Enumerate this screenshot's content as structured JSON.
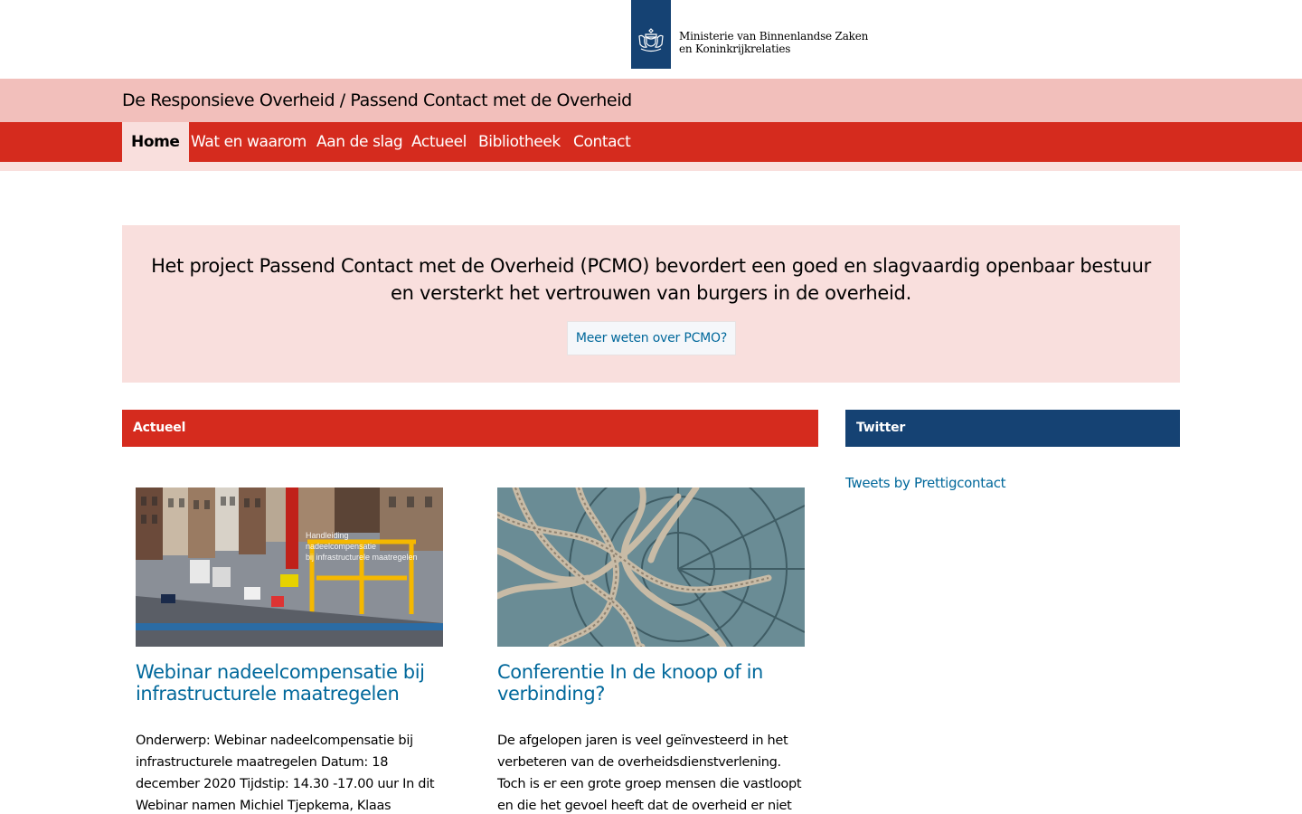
{
  "header": {
    "ministry_line1": "Ministerie van Binnenlandse Zaken",
    "ministry_line2": "en Koninkrijkrelaties",
    "logo_icon": "crest-icon",
    "brand_color": "#154273"
  },
  "site": {
    "title": "De Responsieve Overheid / Passend Contact met de Overheid"
  },
  "nav": {
    "items": [
      {
        "label": "Home",
        "active": true
      },
      {
        "label": "Wat en waarom",
        "active": false
      },
      {
        "label": "Aan de slag",
        "active": false
      },
      {
        "label": "Actueel",
        "active": false
      },
      {
        "label": "Bibliotheek",
        "active": false
      },
      {
        "label": "Contact",
        "active": false
      }
    ],
    "color": "#d52b1e"
  },
  "intro": {
    "text": "Het project Passend Contact met de Overheid (PCMO) bevordert een goed en slagvaardig openbaar bestuur en versterkt het vertrouwen van burgers in de overheid.",
    "button_label": "Meer weten over PCMO?"
  },
  "sections": {
    "actueel_title": "Actueel",
    "twitter_title": "Twitter",
    "twitter_link": "Tweets by Prettigcontact"
  },
  "cards": [
    {
      "image": "road-construction-photo",
      "title": "Webinar nadeelcompensatie bij infrastructurele maatregelen",
      "text": "Onderwerp: Webinar nadeelcompensatie bij infrastructurele maatregelen Datum: 18 december 2020 Tijdstip: 14.30 -17.00 uur In dit Webinar namen Michiel Tjepkema, Klaas Mijnheer, Ivo van"
    },
    {
      "image": "knotted-ropes-photo",
      "title": "Conferentie In de knoop of in verbinding?",
      "text": "De afgelopen jaren is veel geïnvesteerd in het verbeteren van de overheidsdienstverlening. Toch is er een grote groep mensen die vastloopt en die het gevoel heeft dat de overheid er niet voor hen"
    }
  ]
}
